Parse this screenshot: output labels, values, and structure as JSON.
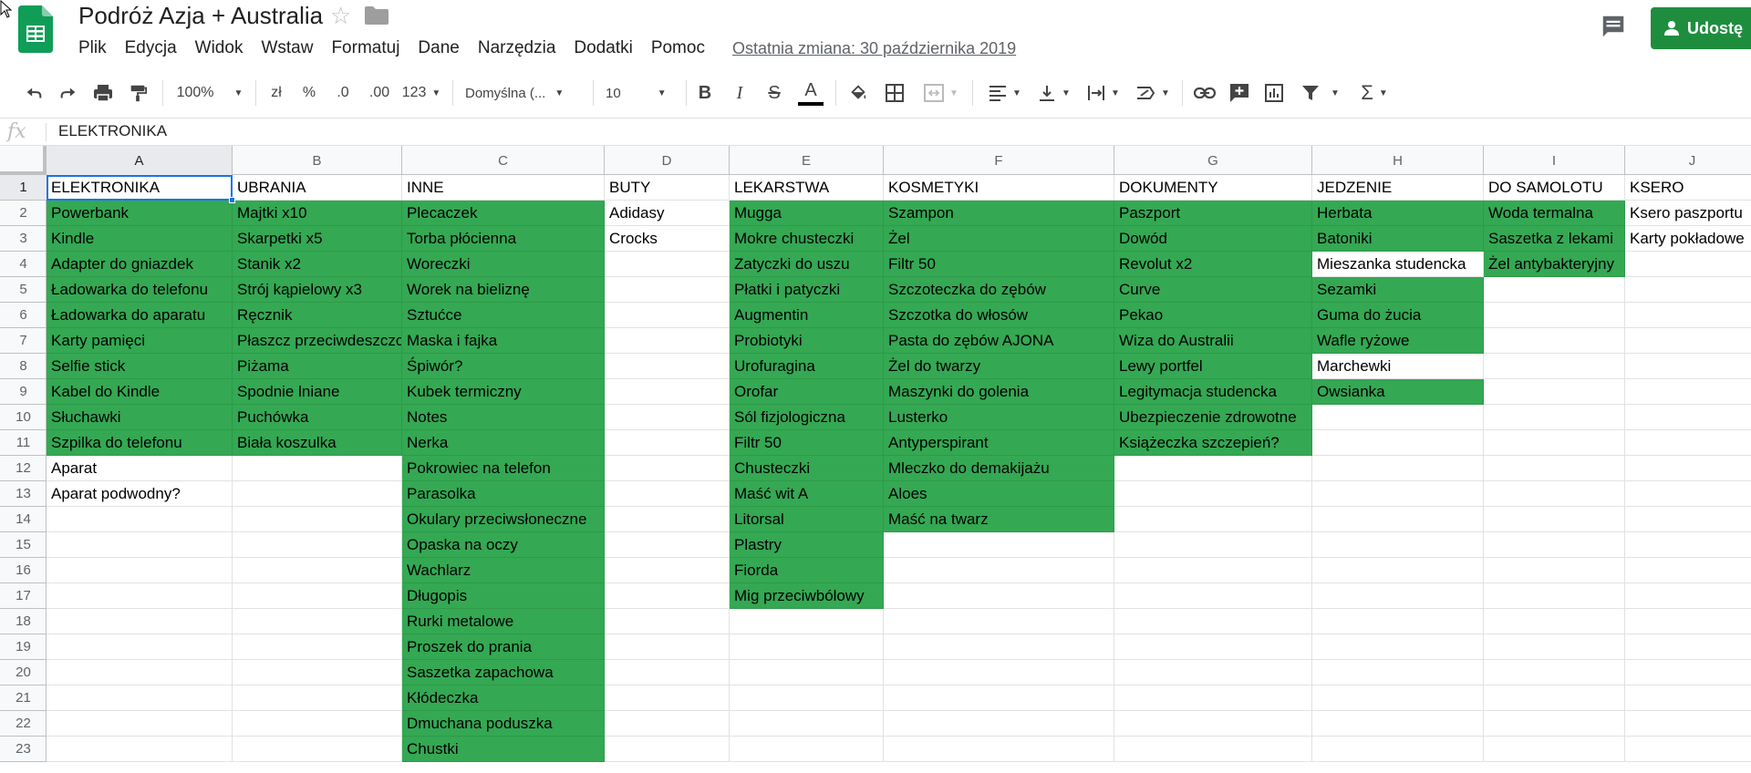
{
  "app": {
    "title": "Podróż Azja + Australia",
    "share_label": "Udostę",
    "last_edit": "Ostatnia zmiana: 30 października 2019",
    "brand_color": "#1e8e3e"
  },
  "menu": [
    "Plik",
    "Edycja",
    "Widok",
    "Wstaw",
    "Formatuj",
    "Dane",
    "Narzędzia",
    "Dodatki",
    "Pomoc"
  ],
  "toolbar": {
    "zoom": "100%",
    "currency": "zł",
    "percent": "%",
    "dec_decrease": ".0",
    "dec_increase": ".00",
    "more_formats": "123",
    "font": "Domyślna (...",
    "font_size": "10",
    "icons": [
      "undo-icon",
      "redo-icon",
      "print-icon",
      "paint-format-icon",
      "bold-icon",
      "italic-icon",
      "strikethrough-icon",
      "text-color-icon",
      "fill-color-icon",
      "borders-icon",
      "merge-cells-icon",
      "align-left-icon",
      "vertical-align-icon",
      "text-wrap-icon",
      "text-rotate-icon",
      "link-icon",
      "comment-icon",
      "chart-icon",
      "filter-icon",
      "functions-icon"
    ]
  },
  "formula_bar": {
    "fx": "fx",
    "value": "ELEKTRONIKA"
  },
  "sheet": {
    "selected_cell": "A1",
    "fill_color": "#34a853",
    "columns": [
      "A",
      "B",
      "C",
      "D",
      "E",
      "F",
      "G",
      "H",
      "I",
      "J"
    ],
    "rows": [
      "1",
      "2",
      "3",
      "4",
      "5",
      "6",
      "7",
      "8",
      "9",
      "10",
      "11",
      "12",
      "13",
      "14",
      "15",
      "16",
      "17",
      "18",
      "19",
      "20",
      "21",
      "22",
      "23"
    ],
    "data": {
      "A": [
        "ELEKTRONIKA",
        "Powerbank",
        "Kindle",
        "Adapter do gniazdek",
        "Ładowarka do telefonu",
        "Ładowarka do aparatu",
        "Karty pamięci",
        "Selfie stick",
        "Kabel do Kindle",
        "Słuchawki",
        "Szpilka do telefonu",
        "Aparat",
        "Aparat podwodny?"
      ],
      "B": [
        "UBRANIA",
        "Majtki x10",
        "Skarpetki x5",
        "Stanik x2",
        "Strój kąpielowy x3",
        "Ręcznik",
        "Płaszcz przeciwdeszczowy",
        "Piżama",
        "Spodnie lniane",
        "Puchówka",
        "Biała koszulka"
      ],
      "C": [
        "INNE",
        "Plecaczek",
        "Torba płócienna",
        "Woreczki",
        "Worek na bieliznę",
        "Sztućce",
        "Maska i fajka",
        "Śpiwór?",
        "Kubek termiczny",
        "Notes",
        "Nerka",
        "Pokrowiec na telefon",
        "Parasolka",
        "Okulary przeciwsłoneczne",
        "Opaska na oczy",
        "Wachlarz",
        "Długopis",
        "Rurki metalowe",
        "Proszek do prania",
        "Saszetka zapachowa",
        "Kłódeczka",
        "Dmuchana poduszka",
        "Chustki"
      ],
      "D": [
        "BUTY",
        "Adidasy",
        "Crocks"
      ],
      "E": [
        "LEKARSTWA",
        "Mugga",
        "Mokre chusteczki",
        "Zatyczki do uszu",
        "Płatki i patyczki",
        "Augmentin",
        "Probiotyki",
        "Urofuragina",
        "Orofar",
        "Sól fizjologiczna",
        "Filtr 50",
        "Chusteczki",
        "Maść wit A",
        "Litorsal",
        "Plastry",
        "Fiorda",
        "Mig przeciwbólowy"
      ],
      "F": [
        "KOSMETYKI",
        "Szampon",
        "Żel",
        "Filtr 50",
        "Szczoteczka do zębów",
        "Szczotka do włosów",
        "Pasta do zębów AJONA",
        "Żel do twarzy",
        "Maszynki do golenia",
        "Lusterko",
        "Antyperspirant",
        "Mleczko do demakijażu",
        "Aloes",
        "Maść na twarz"
      ],
      "G": [
        "DOKUMENTY",
        "Paszport",
        "Dowód",
        "Revolut x2",
        "Curve",
        "Pekao",
        "Wiza do Australii",
        "Lewy portfel",
        "Legitymacja studencka",
        "Ubezpieczenie zdrowotne",
        "Książeczka szczepień?"
      ],
      "H": [
        "JEDZENIE",
        "Herbata",
        "Batoniki",
        "Mieszanka studencka",
        "Sezamki",
        "Guma do żucia",
        "Wafle ryżowe",
        "Marchewki",
        "Owsianka"
      ],
      "I": [
        "DO SAMOLOTU",
        "Woda termalna",
        "Saszetka z lekami",
        "Żel antybakteryjny"
      ],
      "J": [
        "KSERO",
        "Ksero paszportu",
        "Karty pokładowe"
      ]
    },
    "green_rows": {
      "A": [
        2,
        11
      ],
      "B": [
        2,
        11
      ],
      "C": [
        2,
        23
      ],
      "E": [
        2,
        17
      ],
      "F": [
        2,
        14
      ],
      "G": [
        2,
        11
      ],
      "H": [
        2,
        9
      ],
      "I": [
        2,
        4
      ]
    },
    "white_exceptions": [
      "H4",
      "H8"
    ]
  }
}
